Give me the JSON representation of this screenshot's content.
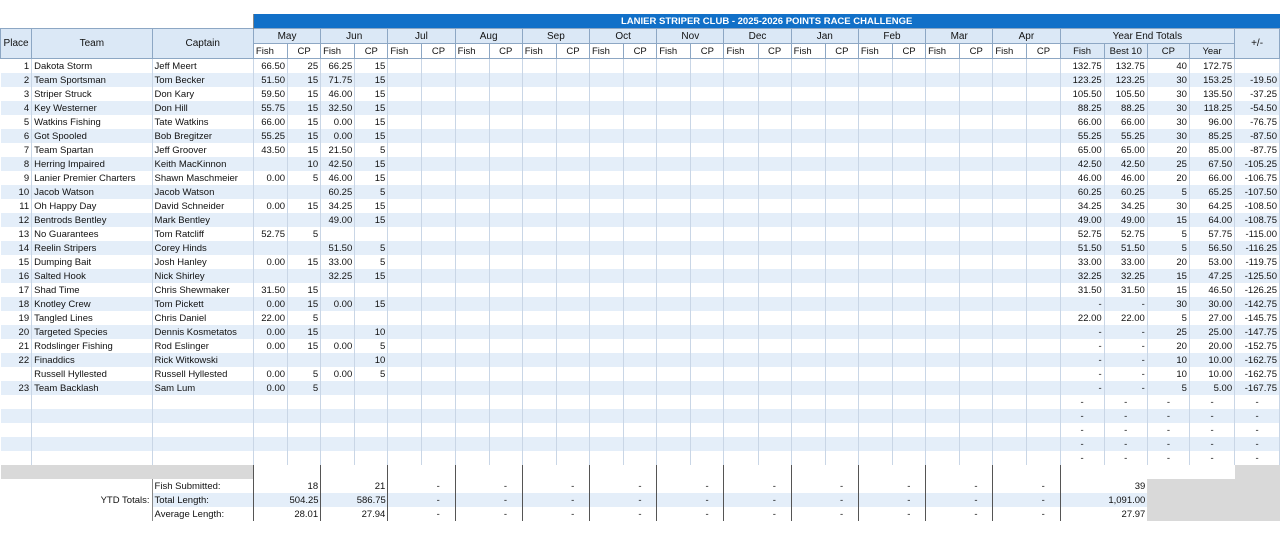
{
  "title": "LANIER STRIPER CLUB - 2025-2026 POINTS RACE CHALLENGE",
  "headers": {
    "place": "Place",
    "team": "Team",
    "captain": "Captain",
    "months": [
      "May",
      "Jun",
      "Jul",
      "Aug",
      "Sep",
      "Oct",
      "Nov",
      "Dec",
      "Jan",
      "Feb",
      "Mar",
      "Apr"
    ],
    "fish": "Fish",
    "cp": "CP",
    "year_end": "Year End Totals",
    "best10": "Best 10",
    "year": "Year",
    "diff": "+/-"
  },
  "rows": [
    {
      "place": "1",
      "team": "Dakota Storm",
      "captain": "Jeff Meert",
      "may_fish": "66.50",
      "may_cp": "25",
      "jun_fish": "66.25",
      "jun_cp": "15",
      "t_fish": "132.75",
      "t_best": "132.75",
      "t_cp": "40",
      "t_year": "172.75",
      "diff": ""
    },
    {
      "place": "2",
      "team": "Team Sportsman",
      "captain": "Tom Becker",
      "may_fish": "51.50",
      "may_cp": "15",
      "jun_fish": "71.75",
      "jun_cp": "15",
      "t_fish": "123.25",
      "t_best": "123.25",
      "t_cp": "30",
      "t_year": "153.25",
      "diff": "-19.50"
    },
    {
      "place": "3",
      "team": "Striper Struck",
      "captain": "Don Kary",
      "may_fish": "59.50",
      "may_cp": "15",
      "jun_fish": "46.00",
      "jun_cp": "15",
      "t_fish": "105.50",
      "t_best": "105.50",
      "t_cp": "30",
      "t_year": "135.50",
      "diff": "-37.25"
    },
    {
      "place": "4",
      "team": "Key Westerner",
      "captain": "Don Hill",
      "may_fish": "55.75",
      "may_cp": "15",
      "jun_fish": "32.50",
      "jun_cp": "15",
      "t_fish": "88.25",
      "t_best": "88.25",
      "t_cp": "30",
      "t_year": "118.25",
      "diff": "-54.50"
    },
    {
      "place": "5",
      "team": "Watkins Fishing",
      "captain": "Tate Watkins",
      "may_fish": "66.00",
      "may_cp": "15",
      "jun_fish": "0.00",
      "jun_cp": "15",
      "t_fish": "66.00",
      "t_best": "66.00",
      "t_cp": "30",
      "t_year": "96.00",
      "diff": "-76.75"
    },
    {
      "place": "6",
      "team": "Got Spooled",
      "captain": "Bob Bregitzer",
      "may_fish": "55.25",
      "may_cp": "15",
      "jun_fish": "0.00",
      "jun_cp": "15",
      "t_fish": "55.25",
      "t_best": "55.25",
      "t_cp": "30",
      "t_year": "85.25",
      "diff": "-87.50"
    },
    {
      "place": "7",
      "team": "Team Spartan",
      "captain": "Jeff Groover",
      "may_fish": "43.50",
      "may_cp": "15",
      "jun_fish": "21.50",
      "jun_cp": "5",
      "t_fish": "65.00",
      "t_best": "65.00",
      "t_cp": "20",
      "t_year": "85.00",
      "diff": "-87.75"
    },
    {
      "place": "8",
      "team": "Herring Impaired",
      "captain": "Keith MacKinnon",
      "may_fish": "",
      "may_cp": "10",
      "jun_fish": "42.50",
      "jun_cp": "15",
      "t_fish": "42.50",
      "t_best": "42.50",
      "t_cp": "25",
      "t_year": "67.50",
      "diff": "-105.25"
    },
    {
      "place": "9",
      "team": "Lanier Premier Charters",
      "captain": "Shawn Maschmeier",
      "may_fish": "0.00",
      "may_cp": "5",
      "jun_fish": "46.00",
      "jun_cp": "15",
      "t_fish": "46.00",
      "t_best": "46.00",
      "t_cp": "20",
      "t_year": "66.00",
      "diff": "-106.75"
    },
    {
      "place": "10",
      "team": "Jacob Watson",
      "captain": "Jacob Watson",
      "may_fish": "",
      "may_cp": "",
      "jun_fish": "60.25",
      "jun_cp": "5",
      "t_fish": "60.25",
      "t_best": "60.25",
      "t_cp": "5",
      "t_year": "65.25",
      "diff": "-107.50"
    },
    {
      "place": "11",
      "team": "Oh Happy Day",
      "captain": "David Schneider",
      "may_fish": "0.00",
      "may_cp": "15",
      "jun_fish": "34.25",
      "jun_cp": "15",
      "t_fish": "34.25",
      "t_best": "34.25",
      "t_cp": "30",
      "t_year": "64.25",
      "diff": "-108.50"
    },
    {
      "place": "12",
      "team": "Bentrods Bentley",
      "captain": "Mark Bentley",
      "may_fish": "",
      "may_cp": "",
      "jun_fish": "49.00",
      "jun_cp": "15",
      "t_fish": "49.00",
      "t_best": "49.00",
      "t_cp": "15",
      "t_year": "64.00",
      "diff": "-108.75"
    },
    {
      "place": "13",
      "team": "No Guarantees",
      "captain": "Tom Ratcliff",
      "may_fish": "52.75",
      "may_cp": "5",
      "jun_fish": "",
      "jun_cp": "",
      "t_fish": "52.75",
      "t_best": "52.75",
      "t_cp": "5",
      "t_year": "57.75",
      "diff": "-115.00"
    },
    {
      "place": "14",
      "team": "Reelin Stripers",
      "captain": "Corey Hinds",
      "may_fish": "",
      "may_cp": "",
      "jun_fish": "51.50",
      "jun_cp": "5",
      "t_fish": "51.50",
      "t_best": "51.50",
      "t_cp": "5",
      "t_year": "56.50",
      "diff": "-116.25"
    },
    {
      "place": "15",
      "team": "Dumping Bait",
      "captain": "Josh Hanley",
      "may_fish": "0.00",
      "may_cp": "15",
      "jun_fish": "33.00",
      "jun_cp": "5",
      "t_fish": "33.00",
      "t_best": "33.00",
      "t_cp": "20",
      "t_year": "53.00",
      "diff": "-119.75"
    },
    {
      "place": "16",
      "team": "Salted Hook",
      "captain": "Nick Shirley",
      "may_fish": "",
      "may_cp": "",
      "jun_fish": "32.25",
      "jun_cp": "15",
      "t_fish": "32.25",
      "t_best": "32.25",
      "t_cp": "15",
      "t_year": "47.25",
      "diff": "-125.50"
    },
    {
      "place": "17",
      "team": "Shad Time",
      "captain": "Chris Shewmaker",
      "may_fish": "31.50",
      "may_cp": "15",
      "jun_fish": "",
      "jun_cp": "",
      "t_fish": "31.50",
      "t_best": "31.50",
      "t_cp": "15",
      "t_year": "46.50",
      "diff": "-126.25"
    },
    {
      "place": "18",
      "team": "Knotley Crew",
      "captain": "Tom Pickett",
      "may_fish": "0.00",
      "may_cp": "15",
      "jun_fish": "0.00",
      "jun_cp": "15",
      "t_fish": "-",
      "t_best": "-",
      "t_cp": "30",
      "t_year": "30.00",
      "diff": "-142.75"
    },
    {
      "place": "19",
      "team": "Tangled Lines",
      "captain": "Chris Daniel",
      "may_fish": "22.00",
      "may_cp": "5",
      "jun_fish": "",
      "jun_cp": "",
      "t_fish": "22.00",
      "t_best": "22.00",
      "t_cp": "5",
      "t_year": "27.00",
      "diff": "-145.75"
    },
    {
      "place": "20",
      "team": "Targeted Species",
      "captain": "Dennis Kosmetatos",
      "may_fish": "0.00",
      "may_cp": "15",
      "jun_fish": "",
      "jun_cp": "10",
      "t_fish": "-",
      "t_best": "-",
      "t_cp": "25",
      "t_year": "25.00",
      "diff": "-147.75"
    },
    {
      "place": "21",
      "team": "Rodslinger Fishing",
      "captain": "Rod Eslinger",
      "may_fish": "0.00",
      "may_cp": "15",
      "jun_fish": "0.00",
      "jun_cp": "5",
      "t_fish": "-",
      "t_best": "-",
      "t_cp": "20",
      "t_year": "20.00",
      "diff": "-152.75"
    },
    {
      "place": "22",
      "team": "Finaddics",
      "captain": "Rick Witkowski",
      "may_fish": "",
      "may_cp": "",
      "jun_fish": "",
      "jun_cp": "10",
      "t_fish": "-",
      "t_best": "-",
      "t_cp": "10",
      "t_year": "10.00",
      "diff": "-162.75"
    },
    {
      "place": "",
      "team": "Russell Hyllested",
      "captain": "Russell Hyllested",
      "may_fish": "0.00",
      "may_cp": "5",
      "jun_fish": "0.00",
      "jun_cp": "5",
      "t_fish": "-",
      "t_best": "-",
      "t_cp": "10",
      "t_year": "10.00",
      "diff": "-162.75"
    },
    {
      "place": "23",
      "team": "Team Backlash",
      "captain": "Sam Lum",
      "may_fish": "0.00",
      "may_cp": "5",
      "jun_fish": "",
      "jun_cp": "",
      "t_fish": "-",
      "t_best": "-",
      "t_cp": "5",
      "t_year": "5.00",
      "diff": "-167.75"
    }
  ],
  "empty_rows": 5,
  "empty_dash": "-",
  "totals": {
    "label": "YTD Totals:",
    "rows": [
      {
        "label": "Fish Submitted:",
        "may": "18",
        "jun": "21",
        "rest": [
          "-",
          "-",
          "-",
          "-",
          "-",
          "-",
          "-",
          "-",
          "-",
          "-"
        ],
        "year": "39"
      },
      {
        "label": "Total Length:",
        "may": "504.25",
        "jun": "586.75",
        "rest": [
          "-",
          "-",
          "-",
          "-",
          "-",
          "-",
          "-",
          "-",
          "-",
          "-"
        ],
        "year": "1,091.00"
      },
      {
        "label": "Average Length:",
        "may": "28.01",
        "jun": "27.94",
        "rest": [
          "-",
          "-",
          "-",
          "-",
          "-",
          "-",
          "-",
          "-",
          "-",
          "-"
        ],
        "year": "27.97"
      }
    ]
  }
}
